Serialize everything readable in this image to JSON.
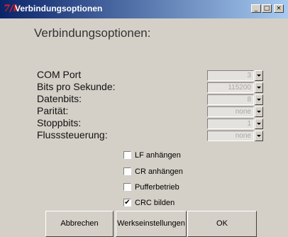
{
  "window": {
    "icon_glyph": "7/k",
    "title": "Verbindungsoptionen",
    "minimize_glyph": "_",
    "maximize_glyph": "□",
    "close_glyph": "×"
  },
  "heading": "Verbindungsoptionen:",
  "settings": [
    {
      "label": "COM Port",
      "value": "3"
    },
    {
      "label": "Bits pro Sekunde:",
      "value": "115200"
    },
    {
      "label": "Datenbits:",
      "value": "8"
    },
    {
      "label": "Parität:",
      "value": "none"
    },
    {
      "label": "Stoppbits:",
      "value": "1"
    },
    {
      "label": "Flusssteuerung:",
      "value": "none"
    }
  ],
  "options": [
    {
      "label": "LF anhängen",
      "checked": false,
      "mark": ""
    },
    {
      "label": "CR anhängen",
      "checked": false,
      "mark": ""
    },
    {
      "label": "Pufferbetrieb",
      "checked": false,
      "mark": ""
    },
    {
      "label": "CRC bilden",
      "checked": true,
      "mark": "✔"
    }
  ],
  "buttons": {
    "cancel": "Abbrechen",
    "defaults": "Werkseinstellungen",
    "ok": "OK"
  }
}
